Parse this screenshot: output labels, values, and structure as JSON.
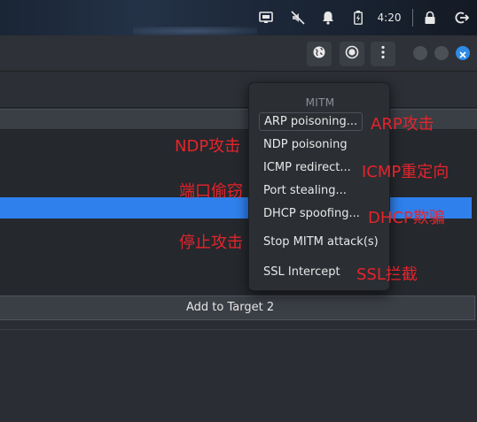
{
  "system_bar": {
    "clock": "4:20",
    "icons": [
      "display-icon",
      "mute-icon",
      "bell-icon",
      "battery-icon",
      "lock-icon",
      "logout-icon"
    ]
  },
  "toolbar": {
    "buttons": [
      "globe-icon",
      "record-icon",
      "more-icon"
    ],
    "window_controls": [
      "minimize-button",
      "maximize-button",
      "close-button"
    ]
  },
  "main": {
    "add_target_label": "Add to Target 2"
  },
  "mitm_menu": {
    "title": "MITM",
    "items": [
      {
        "label": "ARP poisoning..."
      },
      {
        "label": "NDP poisoning"
      },
      {
        "label": "ICMP redirect..."
      },
      {
        "label": "Port stealing..."
      },
      {
        "label": "DHCP spoofing..."
      },
      {
        "label": "Stop MITM attack(s)"
      },
      {
        "label": "SSL Intercept"
      }
    ]
  },
  "annotations": {
    "arp": "ARP攻击",
    "ndp": "NDP攻击",
    "icmp": "ICMP重定向",
    "port": "端口偷窃",
    "dhcp": "DHCP欺骗",
    "stop": "停止攻击",
    "ssl": "SSL拦截"
  },
  "colors": {
    "selection": "#2f80ed",
    "annotation": "#e5242b",
    "close_button": "#2f8be6"
  }
}
